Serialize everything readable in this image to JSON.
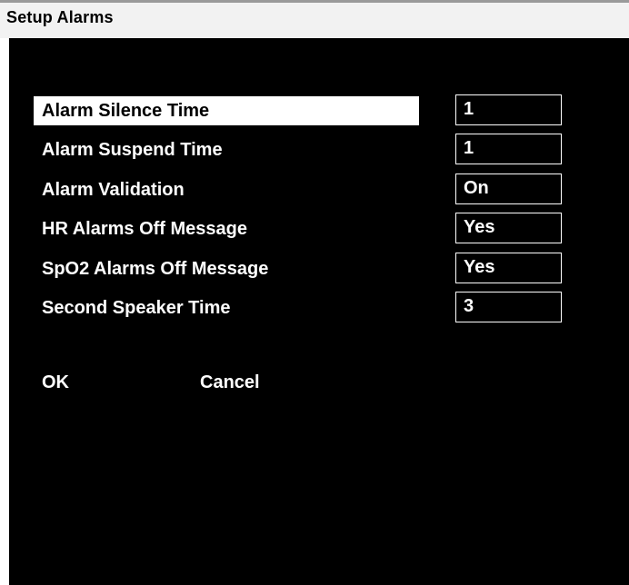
{
  "window": {
    "title": "Setup Alarms"
  },
  "settings": [
    {
      "label": "Alarm Silence Time",
      "value": "1",
      "selected": true
    },
    {
      "label": "Alarm Suspend Time",
      "value": "1",
      "selected": false
    },
    {
      "label": "Alarm Validation",
      "value": "On",
      "selected": false
    },
    {
      "label": "HR Alarms Off Message",
      "value": "Yes",
      "selected": false
    },
    {
      "label": "SpO2 Alarms Off Message",
      "value": "Yes",
      "selected": false
    },
    {
      "label": "Second Speaker Time",
      "value": "3",
      "selected": false
    }
  ],
  "buttons": {
    "ok_label": "OK",
    "cancel_label": "Cancel"
  },
  "colors": {
    "panel_background": "#000000",
    "title_background": "#f2f2f2",
    "text": "#ffffff",
    "selection_highlight": "#ffffff"
  }
}
